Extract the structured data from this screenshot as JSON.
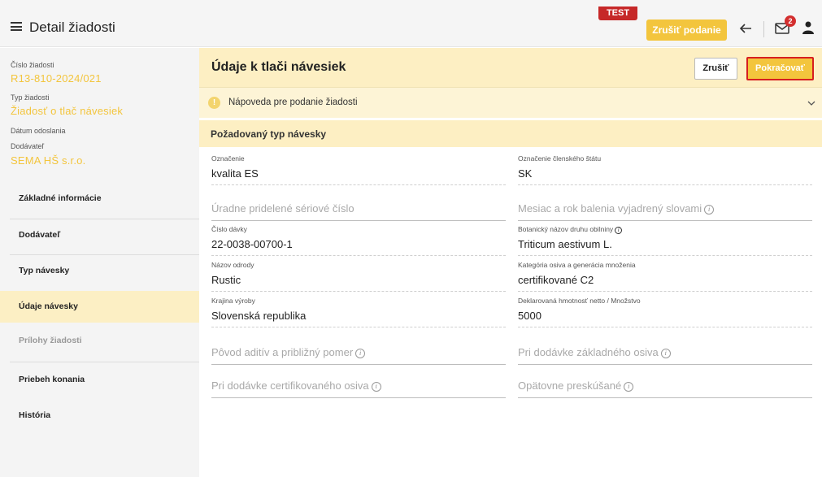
{
  "header": {
    "title": "Detail žiadosti",
    "test_badge": "TEST",
    "cancel_submission": "Zrušiť podanie",
    "mail_count": "2"
  },
  "sidebar": {
    "meta": [
      {
        "label": "Číslo žiadosti",
        "value": "R13-810-2024/021"
      },
      {
        "label": "Typ žiadosti",
        "value": "Žiadosť o tlač návesiek"
      },
      {
        "label": "Dátum odoslania",
        "value": ""
      },
      {
        "label": "Dodávateľ",
        "value": "SEMA HŠ s.r.o."
      }
    ],
    "items": [
      {
        "label": "Základné informácie"
      },
      {
        "label": "Dodávateľ"
      },
      {
        "label": "Typ návesky"
      },
      {
        "label": "Údaje návesky"
      },
      {
        "label": "Prílohy žiadosti"
      },
      {
        "label": "Priebeh konania"
      },
      {
        "label": "História"
      }
    ]
  },
  "main": {
    "title": "Údaje k tlači návesiek",
    "cancel": "Zrušiť",
    "continue": "Pokračovať",
    "help": "Nápoveda pre podanie žiadosti",
    "help_icon_glyph": "!",
    "section": "Požadovaný typ návesky",
    "fields": {
      "oznacenie": {
        "label": "Označenie",
        "value": "kvalita ES"
      },
      "stat": {
        "label": "Označenie členského štátu",
        "value": "SK"
      },
      "seriove": {
        "placeholder": "Úradne pridelené sériové číslo"
      },
      "mesiac": {
        "placeholder": "Mesiac a rok balenia vyjadrený slovami"
      },
      "davka": {
        "label": "Číslo dávky",
        "value": "22-0038-00700-1"
      },
      "botanicky": {
        "label": "Botanický názov druhu obilniny",
        "value": "Triticum aestivum L."
      },
      "odroda": {
        "label": "Názov odrody",
        "value": "Rustic"
      },
      "kategoria": {
        "label": "Kategória osiva a generácia množenia",
        "value": "certifikované C2"
      },
      "krajina": {
        "label": "Krajina výroby",
        "value": "Slovenská republika"
      },
      "hmotnost": {
        "label": "Deklarovaná hmotnosť netto / Množstvo",
        "value": "5000"
      },
      "povod": {
        "placeholder": "Pôvod aditív a približný pomer"
      },
      "zakladne": {
        "placeholder": "Pri dodávke základného osiva"
      },
      "certifikovane": {
        "placeholder": "Pri dodávke certifikovaného osiva"
      },
      "preskusane": {
        "placeholder": "Opätovne preskúšané"
      }
    },
    "info_glyph": "i"
  },
  "colors": {
    "accent": "#f3c53d",
    "header_bg": "#fdefc3",
    "badge_red": "#c62828",
    "highlight_border": "#d71f1f"
  }
}
